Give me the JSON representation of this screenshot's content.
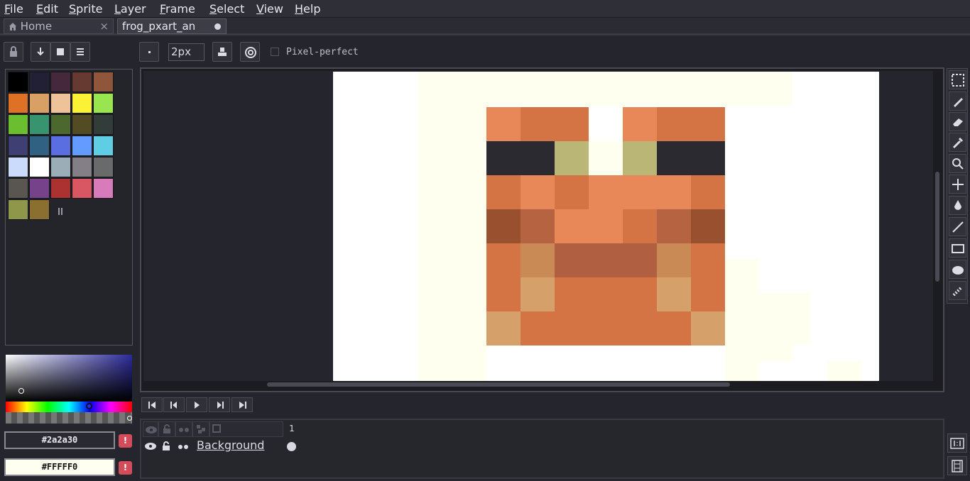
{
  "menu": {
    "items": [
      {
        "key": "F",
        "rest": "ile"
      },
      {
        "key": "E",
        "rest": "dit"
      },
      {
        "key": "S",
        "rest": "prite"
      },
      {
        "key": "L",
        "rest": "ayer"
      },
      {
        "key": "F",
        "rest": "rame"
      },
      {
        "key": "S",
        "rest": "elect"
      },
      {
        "key": "V",
        "rest": "iew"
      },
      {
        "key": "H",
        "rest": "elp"
      }
    ]
  },
  "tabs": [
    {
      "label": "Home",
      "active": false
    },
    {
      "label": "frog_pxart_an",
      "active": true
    }
  ],
  "tool_options": {
    "brush_size": "2px",
    "pixel_perfect_label": "Pixel-perfect"
  },
  "palette": {
    "colors": [
      "#000000",
      "#222034",
      "#45283c",
      "#663931",
      "#8f563b",
      "#df7126",
      "#d9a066",
      "#eec39a",
      "#fbf236",
      "#99e550",
      "#6abe30",
      "#37946e",
      "#4b692f",
      "#524b24",
      "#323c39",
      "#3f3f74",
      "#306082",
      "#5b6ee1",
      "#639bff",
      "#5fcde4",
      "#cbdbfc",
      "#ffffff",
      "#9badb7",
      "#847e87",
      "#696a6a",
      "#595652",
      "#76428a",
      "#ac3232",
      "#d95763",
      "#d77bba",
      "#8f974a",
      "#8a6f30"
    ]
  },
  "colors": {
    "foreground_hex": "#2a2a30",
    "background_hex": "#FFFFF0",
    "foreground": "#2a2a30",
    "background": "#fffff0"
  },
  "sprite": {
    "pixels": [
      {
        "c": "#e88858"
      },
      {
        "c": "#d47444"
      },
      {
        "c": "#d47444"
      },
      {
        "c": "#ffffff"
      },
      {
        "c": "#e88858"
      },
      {
        "c": "#d47444"
      },
      {
        "c": "#d47444"
      },
      {
        "c": "#2a2a30"
      },
      {
        "c": "#2a2a30"
      },
      {
        "c": "#b9b676"
      },
      {
        "c": "#fffff0"
      },
      {
        "c": "#b9b676"
      },
      {
        "c": "#2a2a30"
      },
      {
        "c": "#2a2a30"
      },
      {
        "c": "#d47444"
      },
      {
        "c": "#e88858"
      },
      {
        "c": "#d47444"
      },
      {
        "c": "#e88858"
      },
      {
        "c": "#e88858"
      },
      {
        "c": "#e88858"
      },
      {
        "c": "#d47444"
      },
      {
        "c": "#98502e"
      },
      {
        "c": "#b56340"
      },
      {
        "c": "#e88858"
      },
      {
        "c": "#e88858"
      },
      {
        "c": "#d47444"
      },
      {
        "c": "#b56340"
      },
      {
        "c": "#98502e"
      },
      {
        "c": "#d47444"
      },
      {
        "c": "#c98a55"
      },
      {
        "c": "#b06040"
      },
      {
        "c": "#b06040"
      },
      {
        "c": "#b06040"
      },
      {
        "c": "#c98a55"
      },
      {
        "c": "#d47444"
      },
      {
        "c": "#d47444"
      },
      {
        "c": "#d6a06a"
      },
      {
        "c": "#d47444"
      },
      {
        "c": "#d47444"
      },
      {
        "c": "#d47444"
      },
      {
        "c": "#d6a06a"
      },
      {
        "c": "#d47444"
      },
      {
        "c": "#d6a06a"
      },
      {
        "c": "#d47444"
      },
      {
        "c": "#d47444"
      },
      {
        "c": "#d47444"
      },
      {
        "c": "#d47444"
      },
      {
        "c": "#d47444"
      },
      {
        "c": "#d6a06a"
      }
    ]
  },
  "timeline": {
    "frame_number": "1",
    "layer_name": "Background"
  }
}
